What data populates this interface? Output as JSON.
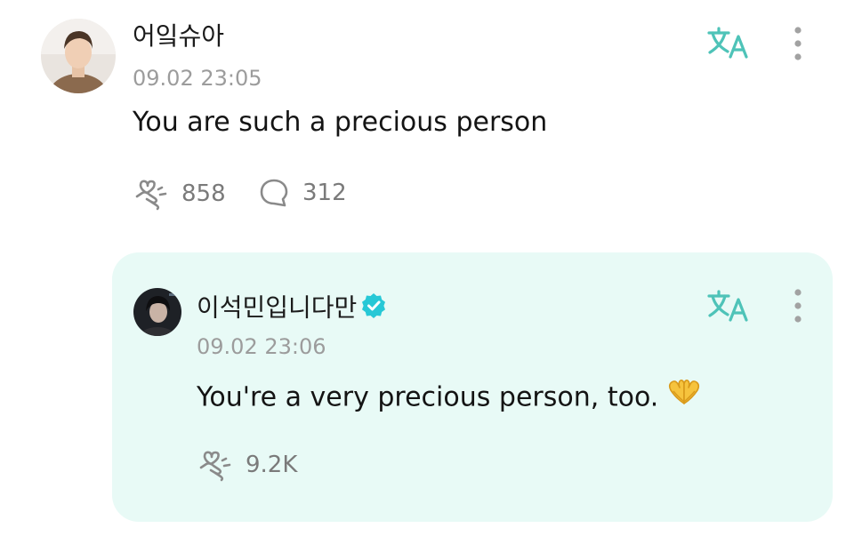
{
  "colors": {
    "accent_teal": "#4ec3b8",
    "verified_blue": "#27c8d6",
    "reply_background": "#e8faf6",
    "muted_text": "#9c9c9c"
  },
  "comment": {
    "username": "어잌슈아",
    "timestamp": "09.02 23:05",
    "text": "You are such a precious person",
    "likes": "858",
    "comments": "312",
    "icons": {
      "translate": "translate-icon",
      "more": "more-vertical-icon",
      "like": "hand-heart-icon",
      "comment": "comment-bubble-icon"
    }
  },
  "reply": {
    "username": "이석민입니다만",
    "verified_icon": "verified-badge-icon",
    "timestamp": "09.02 23:06",
    "text": "You're a very precious person, too.",
    "emoji": "heart-hands-emoji",
    "likes": "9.2K",
    "icons": {
      "translate": "translate-icon",
      "more": "more-vertical-icon",
      "like": "hand-heart-icon"
    }
  }
}
